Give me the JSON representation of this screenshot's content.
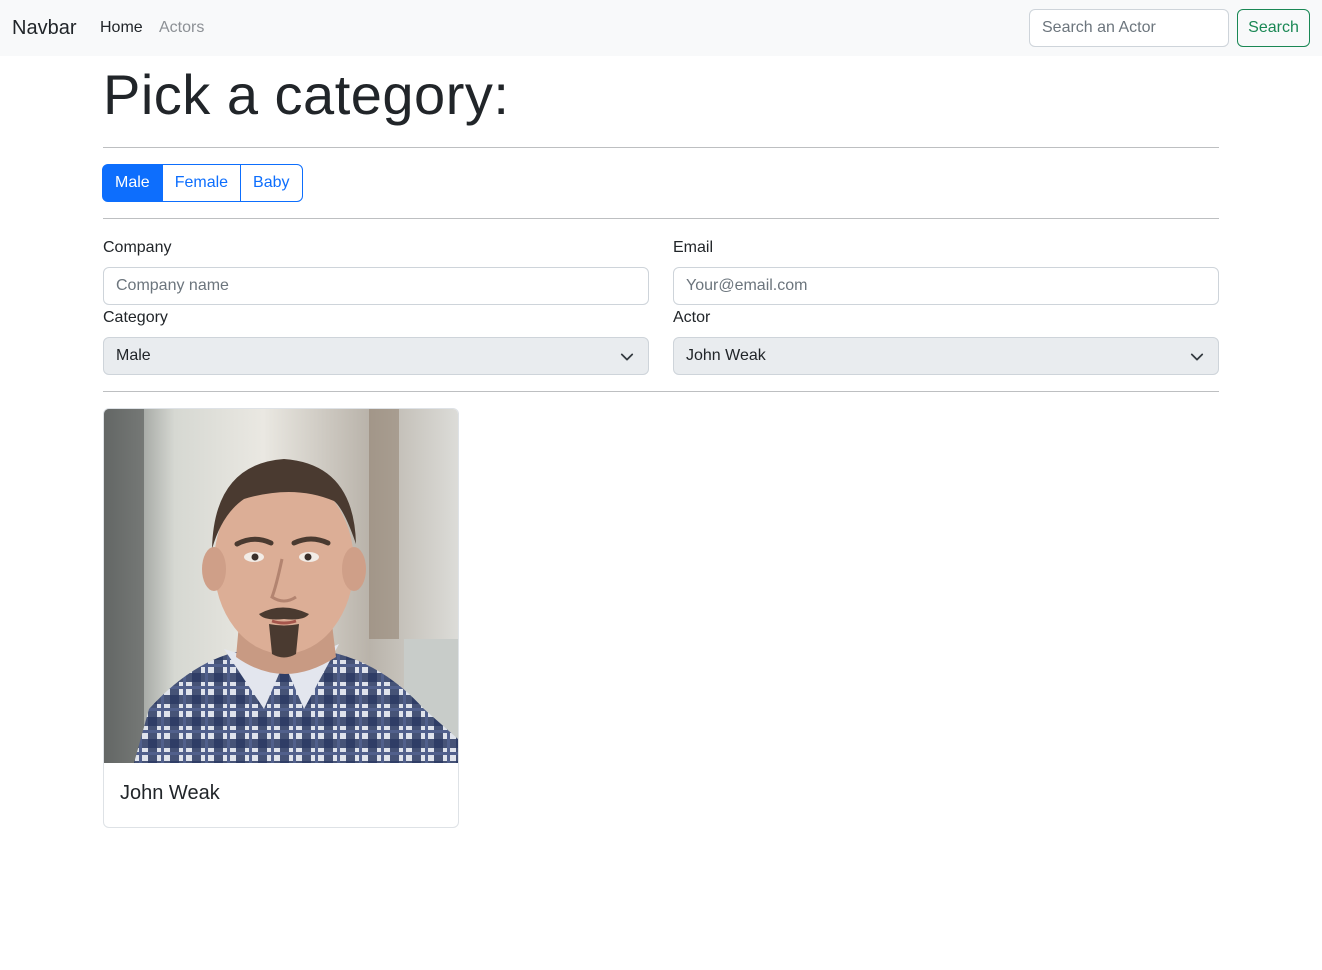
{
  "navbar": {
    "brand": "Navbar",
    "links": [
      {
        "label": "Home"
      },
      {
        "label": "Actors"
      }
    ],
    "search": {
      "placeholder": "Search an Actor",
      "button_label": "Search"
    }
  },
  "main": {
    "title": "Pick a category:",
    "category_buttons": [
      {
        "label": "Male",
        "active": true
      },
      {
        "label": "Female",
        "active": false
      },
      {
        "label": "Baby",
        "active": false
      }
    ],
    "form": {
      "company": {
        "label": "Company",
        "placeholder": "Company name",
        "value": ""
      },
      "email": {
        "label": "Email",
        "placeholder": "Your@email.com",
        "value": ""
      },
      "category": {
        "label": "Category",
        "selected": "Male"
      },
      "actor": {
        "label": "Actor",
        "selected": "John Weak"
      }
    },
    "card": {
      "name": "John Weak"
    }
  },
  "colors": {
    "primary": "#0d6efd",
    "success": "#198754",
    "navbar_bg": "#f8f9fa",
    "select_bg": "#e9ecef"
  }
}
